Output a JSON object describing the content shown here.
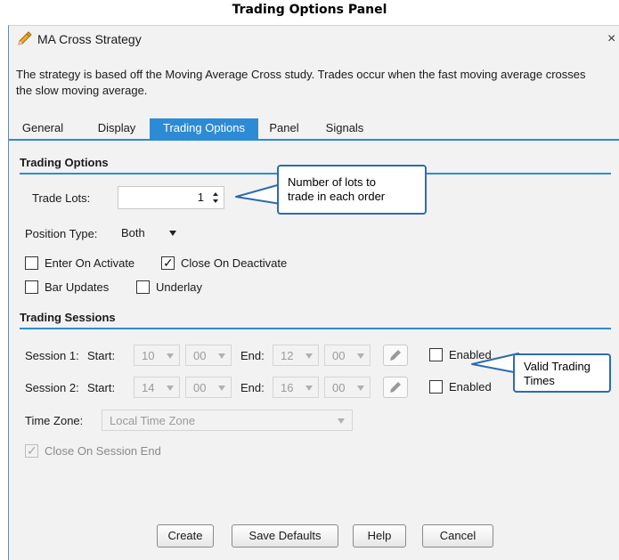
{
  "caption": "Trading Options Panel",
  "window": {
    "title": "MA Cross Strategy",
    "close_glyph": "×",
    "description": "The strategy is based off the Moving Average Cross study. Trades occur when the fast moving average crosses the slow moving average."
  },
  "tabs": [
    {
      "label": "General",
      "active": false
    },
    {
      "label": "Display",
      "active": false
    },
    {
      "label": "Trading Options",
      "active": true
    },
    {
      "label": "Panel",
      "active": false
    },
    {
      "label": "Signals",
      "active": false
    }
  ],
  "trading_options": {
    "heading": "Trading Options",
    "trade_lots_label": "Trade Lots:",
    "trade_lots_value": "1",
    "position_type_label": "Position Type:",
    "position_type_value": "Both",
    "enter_on_activate": {
      "label": "Enter On Activate",
      "checked": false
    },
    "close_on_deactivate": {
      "label": "Close On Deactivate",
      "checked": true
    },
    "bar_updates": {
      "label": "Bar Updates",
      "checked": false
    },
    "underlay": {
      "label": "Underlay",
      "checked": false
    }
  },
  "trading_sessions": {
    "heading": "Trading Sessions",
    "start_label": "Start:",
    "end_label": "End:",
    "sessions": [
      {
        "label": "Session 1:",
        "start_hour": "10",
        "start_min": "00",
        "end_hour": "12",
        "end_min": "00",
        "enabled_label": "Enabled",
        "enabled": false
      },
      {
        "label": "Session 2:",
        "start_hour": "14",
        "start_min": "00",
        "end_hour": "16",
        "end_min": "00",
        "enabled_label": "Enabled",
        "enabled": false
      }
    ],
    "time_zone_label": "Time Zone:",
    "time_zone_value": "Local Time Zone",
    "close_on_session_end": {
      "label": "Close On Session End",
      "checked": true
    }
  },
  "buttons": {
    "create": "Create",
    "save_defaults": "Save Defaults",
    "help": "Help",
    "cancel": "Cancel"
  },
  "callouts": {
    "lots_line1": "Number of lots to",
    "lots_line2": "trade in each order",
    "times_line1": "Valid Trading",
    "times_line2": "Times"
  },
  "colors": {
    "accent": "#2d8bd5",
    "callout_border": "#2d6bb0",
    "dialog_bg": "#f2f2f2"
  },
  "icons": [
    "pencil-icon",
    "close-icon",
    "spinner-arrows-icon",
    "dropdown-arrow-icon",
    "edit-pencil-icon",
    "checkmark-icon"
  ]
}
